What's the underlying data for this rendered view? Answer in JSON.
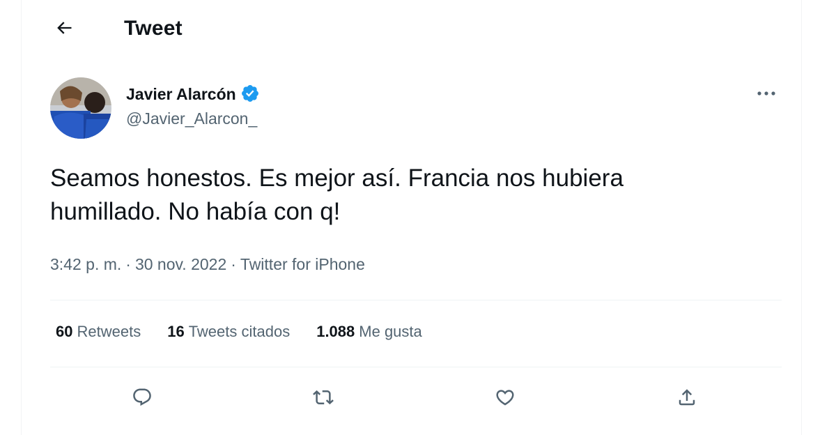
{
  "header": {
    "title": "Tweet"
  },
  "author": {
    "name": "Javier Alarcón",
    "handle": "@Javier_Alarcon_",
    "verified": true
  },
  "tweet": {
    "text": "Seamos honestos. Es mejor así. Francia nos hubiera\nhumillado. No había con q!",
    "time": "3:42 p. m.",
    "separator": "·",
    "date": "30 nov. 2022",
    "source": "Twitter for iPhone"
  },
  "stats": {
    "retweets_count": "60",
    "retweets_label": "Retweets",
    "quotes_count": "16",
    "quotes_label": "Tweets citados",
    "likes_count": "1.088",
    "likes_label": "Me gusta"
  },
  "icons": {
    "back": "arrow-left-icon",
    "more": "more-dots-icon",
    "verified": "verified-badge-icon",
    "reply": "reply-bubble-icon",
    "retweet": "retweet-icon",
    "like": "heart-icon",
    "share": "share-icon"
  },
  "colors": {
    "verified_blue": "#1d9bf0",
    "secondary_text": "#536471",
    "primary_text": "#0f1419"
  }
}
